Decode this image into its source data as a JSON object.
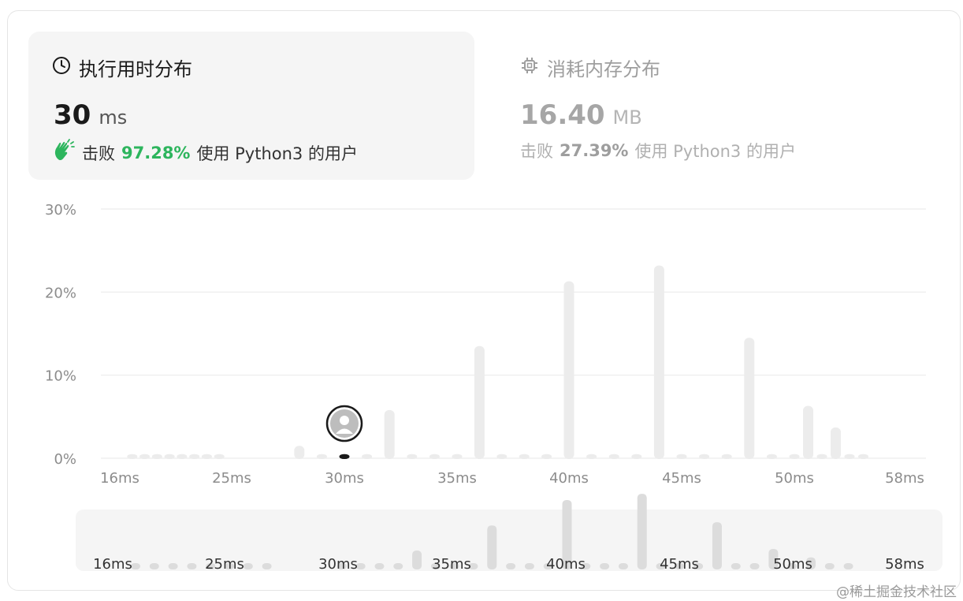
{
  "runtime": {
    "title": "执行用时分布",
    "value": "30",
    "unit": "ms",
    "beats_prefix": "击败",
    "beats_pct": "97.28%",
    "beats_suffix": "使用 Python3 的用户"
  },
  "memory": {
    "title": "消耗内存分布",
    "value": "16.40",
    "unit": "MB",
    "beats_prefix": "击败",
    "beats_pct": "27.39%",
    "beats_suffix": "使用 Python3 的用户"
  },
  "watermark": "@稀土掘金技术社区",
  "chart_data": {
    "type": "bar",
    "xlabel": "",
    "ylabel": "",
    "ylim": [
      0,
      30
    ],
    "y_ticks": [
      "30%",
      "20%",
      "10%",
      "0%"
    ],
    "y_tick_values": [
      30,
      20,
      10,
      0
    ],
    "x_tick_labels": [
      "16ms",
      "25ms",
      "30ms",
      "35ms",
      "40ms",
      "45ms",
      "50ms",
      "58ms"
    ],
    "x_tick_values": [
      16,
      25,
      30,
      35,
      40,
      45,
      50,
      58
    ],
    "values": [
      {
        "x": 17,
        "y": 0.5
      },
      {
        "x": 18,
        "y": 0.5
      },
      {
        "x": 19,
        "y": 0.5
      },
      {
        "x": 20,
        "y": 0.5
      },
      {
        "x": 21,
        "y": 0.5
      },
      {
        "x": 22,
        "y": 0.5
      },
      {
        "x": 23,
        "y": 0.5
      },
      {
        "x": 24,
        "y": 0.5
      },
      {
        "x": 28,
        "y": 1.5
      },
      {
        "x": 29,
        "y": 0.5
      },
      {
        "x": 30,
        "y": 0.5
      },
      {
        "x": 31,
        "y": 0.5
      },
      {
        "x": 32,
        "y": 5.8
      },
      {
        "x": 33,
        "y": 0.5
      },
      {
        "x": 34,
        "y": 0.5
      },
      {
        "x": 35,
        "y": 0.5
      },
      {
        "x": 36,
        "y": 13.5
      },
      {
        "x": 37,
        "y": 0.5
      },
      {
        "x": 38,
        "y": 0.5
      },
      {
        "x": 39,
        "y": 0.5
      },
      {
        "x": 40,
        "y": 21.3
      },
      {
        "x": 41,
        "y": 0.5
      },
      {
        "x": 42,
        "y": 0.5
      },
      {
        "x": 43,
        "y": 0.5
      },
      {
        "x": 44,
        "y": 23.2
      },
      {
        "x": 45,
        "y": 0.5
      },
      {
        "x": 46,
        "y": 0.5
      },
      {
        "x": 47,
        "y": 0.5
      },
      {
        "x": 48,
        "y": 14.5
      },
      {
        "x": 49,
        "y": 0.5
      },
      {
        "x": 50,
        "y": 0.5
      },
      {
        "x": 51,
        "y": 6.3
      },
      {
        "x": 52,
        "y": 0.5
      },
      {
        "x": 53,
        "y": 3.7
      },
      {
        "x": 54,
        "y": 0.5
      },
      {
        "x": 55,
        "y": 0.5
      }
    ],
    "highlight_x": 30,
    "grid": true,
    "colors": {
      "bar": "#ececec",
      "highlight": "#1a1a1a",
      "grid": "#ececec",
      "tick_text": "#8c8c8c",
      "accent_green": "#2db55d"
    }
  }
}
